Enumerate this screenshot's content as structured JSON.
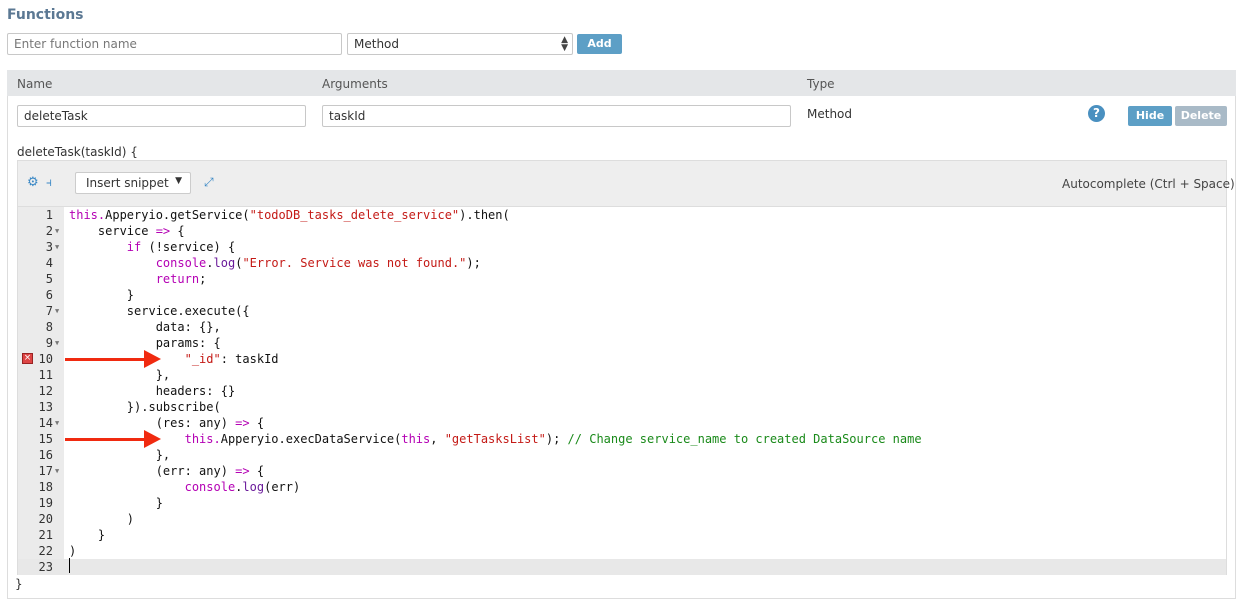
{
  "title": "Functions",
  "new_function": {
    "placeholder": "Enter function name",
    "type_select": "Method",
    "add_label": "Add"
  },
  "table": {
    "headers": [
      "Name",
      "Arguments",
      "Type"
    ],
    "row": {
      "name": "deleteTask",
      "arguments": "taskId",
      "type": "Method",
      "hide_label": "Hide",
      "delete_label": "Delete",
      "help_icon": "question-circle-icon"
    }
  },
  "signature": "deleteTask(taskId) {",
  "closing": "}",
  "editor": {
    "insert_snippet": "Insert snippet",
    "autocomplete_hint": "Autocomplete (Ctrl + Space)",
    "error_line": 10,
    "arrow_lines": [
      10,
      15
    ],
    "active_line": 23,
    "lines": [
      {
        "n": "1",
        "f": false,
        "tok": [
          [
            "kw",
            "this."
          ],
          [
            "pl",
            "Apperyio.getService("
          ],
          [
            "str",
            "\"todoDB_tasks_delete_service\""
          ],
          [
            "pl",
            ").then("
          ]
        ]
      },
      {
        "n": "2",
        "f": true,
        "tok": [
          [
            "pl",
            "    service "
          ],
          [
            "kw",
            "=>"
          ],
          [
            "pl",
            " {"
          ]
        ]
      },
      {
        "n": "3",
        "f": true,
        "tok": [
          [
            "pl",
            "        "
          ],
          [
            "kw",
            "if"
          ],
          [
            "pl",
            " (!service) {"
          ]
        ]
      },
      {
        "n": "4",
        "f": false,
        "tok": [
          [
            "pl",
            "            "
          ],
          [
            "kw",
            "console"
          ],
          [
            "pl",
            "."
          ],
          [
            "fn",
            "log"
          ],
          [
            "pl",
            "("
          ],
          [
            "str",
            "\"Error. Service was not found.\""
          ],
          [
            "pl",
            ");"
          ]
        ]
      },
      {
        "n": "5",
        "f": false,
        "tok": [
          [
            "pl",
            "            "
          ],
          [
            "kw",
            "return"
          ],
          [
            "pl",
            ";"
          ]
        ]
      },
      {
        "n": "6",
        "f": false,
        "tok": [
          [
            "pl",
            "        }"
          ]
        ]
      },
      {
        "n": "7",
        "f": true,
        "tok": [
          [
            "pl",
            "        service.execute({"
          ]
        ]
      },
      {
        "n": "8",
        "f": false,
        "tok": [
          [
            "pl",
            "            data: {},"
          ]
        ]
      },
      {
        "n": "9",
        "f": true,
        "tok": [
          [
            "pl",
            "            params: {"
          ]
        ]
      },
      {
        "n": "10",
        "f": false,
        "tok": [
          [
            "pl",
            "                "
          ],
          [
            "str",
            "\"_id\""
          ],
          [
            "pl",
            ": taskId"
          ]
        ]
      },
      {
        "n": "11",
        "f": false,
        "tok": [
          [
            "pl",
            "            },"
          ]
        ]
      },
      {
        "n": "12",
        "f": false,
        "tok": [
          [
            "pl",
            "            headers: {}"
          ]
        ]
      },
      {
        "n": "13",
        "f": false,
        "tok": [
          [
            "pl",
            "        }).subscribe("
          ]
        ]
      },
      {
        "n": "14",
        "f": true,
        "tok": [
          [
            "pl",
            "            (res: any) "
          ],
          [
            "kw",
            "=>"
          ],
          [
            "pl",
            " {"
          ]
        ]
      },
      {
        "n": "15",
        "f": false,
        "tok": [
          [
            "pl",
            "                "
          ],
          [
            "kw",
            "this."
          ],
          [
            "pl",
            "Apperyio.execDataService("
          ],
          [
            "kw",
            "this"
          ],
          [
            "pl",
            ", "
          ],
          [
            "str",
            "\"getTasksList\""
          ],
          [
            "pl",
            "); "
          ],
          [
            "cm",
            "// Change service_name to created DataSource name"
          ]
        ]
      },
      {
        "n": "16",
        "f": false,
        "tok": [
          [
            "pl",
            "            },"
          ]
        ]
      },
      {
        "n": "17",
        "f": true,
        "tok": [
          [
            "pl",
            "            (err: any) "
          ],
          [
            "kw",
            "=>"
          ],
          [
            "pl",
            " {"
          ]
        ]
      },
      {
        "n": "18",
        "f": false,
        "tok": [
          [
            "pl",
            "                "
          ],
          [
            "kw",
            "console"
          ],
          [
            "pl",
            "."
          ],
          [
            "fn",
            "log"
          ],
          [
            "pl",
            "(err)"
          ]
        ]
      },
      {
        "n": "19",
        "f": false,
        "tok": [
          [
            "pl",
            "            }"
          ]
        ]
      },
      {
        "n": "20",
        "f": false,
        "tok": [
          [
            "pl",
            "        )"
          ]
        ]
      },
      {
        "n": "21",
        "f": false,
        "tok": [
          [
            "pl",
            "    }"
          ]
        ]
      },
      {
        "n": "22",
        "f": false,
        "tok": [
          [
            "pl",
            ")"
          ]
        ]
      },
      {
        "n": "23",
        "f": false,
        "tok": []
      }
    ]
  }
}
